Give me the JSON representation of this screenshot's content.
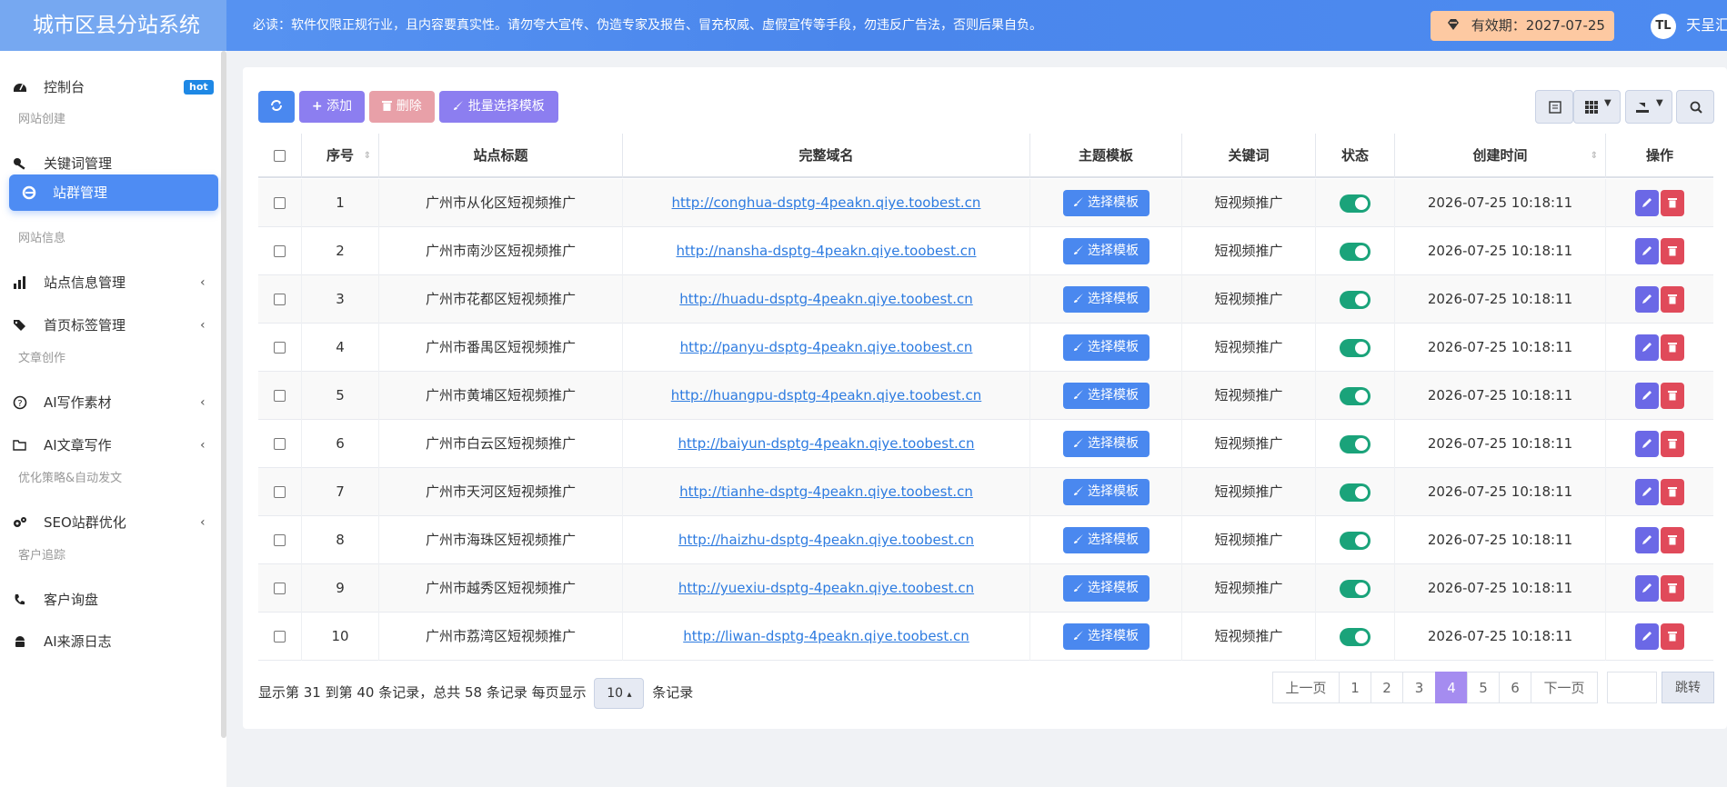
{
  "header": {
    "brand": "城市区县分站系统",
    "notice": "必读：软件仅限正规行业，且内容要真实性。请勿夸大宣传、伪造专家及报告、冒充权威、虚假宣传等手段，勿违反广告法，否则后果自负。",
    "expiry": "有效期：2027-07-25",
    "user": "天呈汇",
    "avatar": "TL"
  },
  "sidebar": {
    "dashboard": "控制台",
    "hot": "hot",
    "sec_site_create": "网站创建",
    "keywords": "关键词管理",
    "station_group": "站群管理",
    "sec_site_info": "网站信息",
    "site_info": "站点信息管理",
    "home_tags": "首页标签管理",
    "sec_article": "文章创作",
    "ai_material": "AI写作素材",
    "ai_article": "AI文章写作",
    "sec_seo": "优化策略&自动发文",
    "seo": "SEO站群优化",
    "sec_customer": "客户追踪",
    "inquiry": "客户询盘",
    "ai_log": "AI来源日志",
    "chevron": "‹"
  },
  "toolbar": {
    "add": "添加",
    "delete": "删除",
    "batch": "批量选择模板"
  },
  "table": {
    "headers": [
      "序号",
      "站点标题",
      "完整域名",
      "主题模板",
      "关键词",
      "状态",
      "创建时间",
      "操作"
    ],
    "template_btn": "选择模板",
    "rows": [
      {
        "id": "1",
        "title": "广州市从化区短视频推广",
        "domain": "http://conghua-dsptg-4peakn.qiye.toobest.cn",
        "keyword": "短视频推广",
        "time": "2026-07-25 10:18:11"
      },
      {
        "id": "2",
        "title": "广州市南沙区短视频推广",
        "domain": "http://nansha-dsptg-4peakn.qiye.toobest.cn",
        "keyword": "短视频推广",
        "time": "2026-07-25 10:18:11"
      },
      {
        "id": "3",
        "title": "广州市花都区短视频推广",
        "domain": "http://huadu-dsptg-4peakn.qiye.toobest.cn",
        "keyword": "短视频推广",
        "time": "2026-07-25 10:18:11"
      },
      {
        "id": "4",
        "title": "广州市番禺区短视频推广",
        "domain": "http://panyu-dsptg-4peakn.qiye.toobest.cn",
        "keyword": "短视频推广",
        "time": "2026-07-25 10:18:11"
      },
      {
        "id": "5",
        "title": "广州市黄埔区短视频推广",
        "domain": "http://huangpu-dsptg-4peakn.qiye.toobest.cn",
        "keyword": "短视频推广",
        "time": "2026-07-25 10:18:11"
      },
      {
        "id": "6",
        "title": "广州市白云区短视频推广",
        "domain": "http://baiyun-dsptg-4peakn.qiye.toobest.cn",
        "keyword": "短视频推广",
        "time": "2026-07-25 10:18:11"
      },
      {
        "id": "7",
        "title": "广州市天河区短视频推广",
        "domain": "http://tianhe-dsptg-4peakn.qiye.toobest.cn",
        "keyword": "短视频推广",
        "time": "2026-07-25 10:18:11"
      },
      {
        "id": "8",
        "title": "广州市海珠区短视频推广",
        "domain": "http://haizhu-dsptg-4peakn.qiye.toobest.cn",
        "keyword": "短视频推广",
        "time": "2026-07-25 10:18:11"
      },
      {
        "id": "9",
        "title": "广州市越秀区短视频推广",
        "domain": "http://yuexiu-dsptg-4peakn.qiye.toobest.cn",
        "keyword": "短视频推广",
        "time": "2026-07-25 10:18:11"
      },
      {
        "id": "10",
        "title": "广州市荔湾区短视频推广",
        "domain": "http://liwan-dsptg-4peakn.qiye.toobest.cn",
        "keyword": "短视频推广",
        "time": "2026-07-25 10:18:11"
      }
    ]
  },
  "footer": {
    "info_prefix": "显示第 31 到第 40 条记录，总共 58 条记录 每页显示",
    "page_size": "10",
    "caret": "▴",
    "info_suffix": "条记录",
    "prev": "上一页",
    "pages": [
      "1",
      "2",
      "3",
      "4",
      "5",
      "6"
    ],
    "current_page": "4",
    "next": "下一页",
    "jump": "跳转",
    "jump_value": ""
  },
  "colors": {
    "header": "#4a86ec",
    "brand": "#76a8f1",
    "active_nav": "#4e8cf3",
    "add": "#8c7ef0",
    "delete": "#e8a0a8",
    "toggle_on": "#1aa37a",
    "current_page": "#a58cf0"
  }
}
